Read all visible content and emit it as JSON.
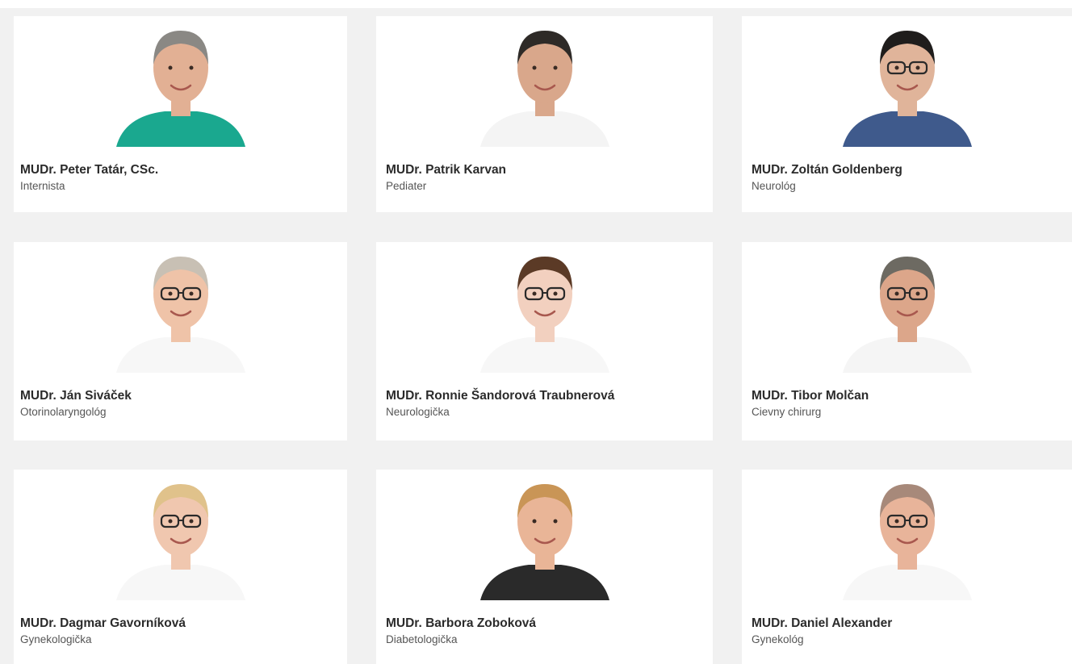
{
  "doctors": [
    {
      "name": "MUDr. Peter Tatár, CSc.",
      "specialty": "Internista",
      "hair": "#8a8884",
      "skin": "#e2b094",
      "shirt": "#1aa88f",
      "glasses": false
    },
    {
      "name": "MUDr. Patrik Karvan",
      "specialty": "Pediater",
      "hair": "#2e2a27",
      "skin": "#d9a78b",
      "shirt": "#f4f4f4",
      "glasses": false
    },
    {
      "name": "MUDr. Zoltán Goldenberg",
      "specialty": "Neurológ",
      "hair": "#1f1d1c",
      "skin": "#e0b49a",
      "shirt": "#3f5a8c",
      "glasses": true
    },
    {
      "name": "MUDr. Ján Siváček",
      "specialty": "Otorinolaryngológ",
      "hair": "#c8c0b4",
      "skin": "#efc3a8",
      "shirt": "#f7f7f7",
      "glasses": true
    },
    {
      "name": "MUDr. Ronnie Šandorová Traubnerová",
      "specialty": "Neurologička",
      "hair": "#5b3a26",
      "skin": "#f2d0bf",
      "shirt": "#f7f7f7",
      "glasses": true
    },
    {
      "name": "MUDr. Tibor Molčan",
      "specialty": "Cievny chirurg",
      "hair": "#6d6a62",
      "skin": "#dca68a",
      "shirt": "#f5f5f5",
      "glasses": true
    },
    {
      "name": "MUDr. Dagmar Gavorníková",
      "specialty": "Gynekologička",
      "hair": "#e0c28b",
      "skin": "#f0c7af",
      "shirt": "#f7f7f7",
      "glasses": true
    },
    {
      "name": "MUDr. Barbora Zoboková",
      "specialty": "Diabetologička",
      "hair": "#c99556",
      "skin": "#e9b597",
      "shirt": "#2a2a2a",
      "glasses": false
    },
    {
      "name": "MUDr. Daniel Alexander",
      "specialty": "Gynekológ",
      "hair": "#a7897a",
      "skin": "#e8b49a",
      "shirt": "#f7f7f7",
      "glasses": true
    }
  ]
}
